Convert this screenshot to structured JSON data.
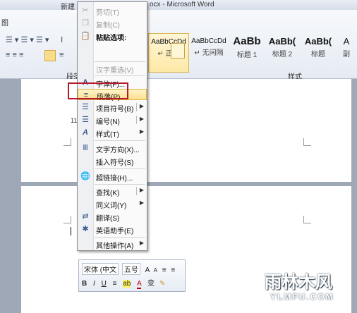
{
  "window": {
    "title_left": "新建",
    "title_right": "ocx - Microsoft Word"
  },
  "ribbon": {
    "left_tab_fragment": "图",
    "paragraph_group_fragment": "段落",
    "styles_group_label": "样式",
    "left_fragment": "11"
  },
  "styles": [
    {
      "preview": "AaBbCcDd",
      "name": "↵ 正文"
    },
    {
      "preview": "AaBbCcDd",
      "name": "↵ 无间隔"
    },
    {
      "preview": "AaBb",
      "name": "标题 1"
    },
    {
      "preview": "AaBb(",
      "name": "标题 2"
    },
    {
      "preview": "AaBb(",
      "name": "标题"
    },
    {
      "preview": "A",
      "name": "副"
    }
  ],
  "context_menu": {
    "items": [
      {
        "label": "剪切(T)",
        "icon": "scissors-icon",
        "disabled": true
      },
      {
        "label": "复制(C)",
        "icon": "copy-icon",
        "disabled": true
      },
      {
        "label": "粘贴选项:",
        "icon": "paste-icon",
        "bold": true
      },
      {
        "label": "汉字重选(V)",
        "icon": "",
        "disabled": true
      },
      {
        "label": "字体(F)...",
        "icon": "font-icon"
      },
      {
        "label": "段落(P)...",
        "icon": "paragraph-icon",
        "highlighted": true
      },
      {
        "label": "项目符号(B)",
        "icon": "bullets-icon",
        "submenu": true
      },
      {
        "label": "编号(N)",
        "icon": "numbering-icon",
        "submenu": true
      },
      {
        "label": "样式(T)",
        "icon": "styles-icon",
        "submenu": true
      },
      {
        "label": "文字方向(X)...",
        "icon": "text-direction-icon"
      },
      {
        "label": "插入符号(S)",
        "icon": ""
      },
      {
        "label": "超链接(H)...",
        "icon": "hyperlink-icon"
      },
      {
        "label": "查找(K)",
        "icon": "",
        "submenu": true
      },
      {
        "label": "同义词(Y)",
        "icon": "",
        "submenu": true
      },
      {
        "label": "翻译(S)",
        "icon": "translate-icon"
      },
      {
        "label": "英语助手(E)",
        "icon": "english-assistant-icon"
      },
      {
        "label": "其他操作(A)",
        "icon": "",
        "submenu": true
      }
    ]
  },
  "mini_toolbar": {
    "font": "宋体 (中文",
    "size": "五号",
    "row1_buttons": [
      "A",
      "A",
      "≡",
      "≡"
    ],
    "row2_buttons": [
      "B",
      "I",
      "U",
      "≡",
      "ab",
      "A",
      "变"
    ]
  },
  "watermark": {
    "cn": "雨林木风",
    "url": "YLMFU.COM"
  }
}
